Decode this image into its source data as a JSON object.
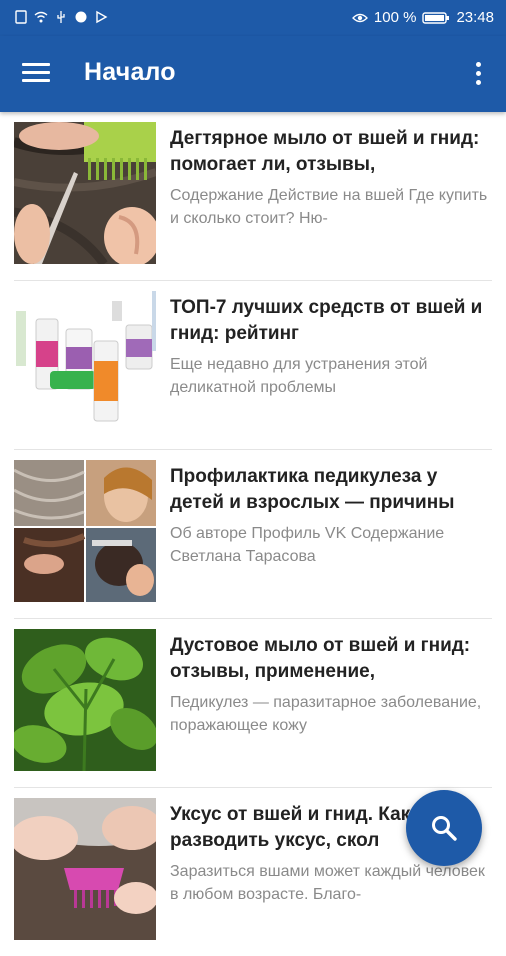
{
  "status_bar": {
    "battery": "100 %",
    "time": "23:48"
  },
  "app_bar": {
    "title": "Начало",
    "menu_icon": "hamburger-menu-icon",
    "more_icon": "more-vert-icon"
  },
  "articles": [
    {
      "headline": "Дегтярное мыло от вшей и гнид: помогает ли, отзывы,",
      "excerpt": "Содержание Действие на вшей Где купить и сколько стоит? Ню-"
    },
    {
      "headline": "ТОП-7 лучших средств от вшей и гнид: рейтинг",
      "excerpt": "Еще недавно для устранения этой деликатной проблемы"
    },
    {
      "headline": "Профилактика педикулеза у детей и взрослых — причины",
      "excerpt": "Об авторе Профиль VK Содержание Светлана Тарасова"
    },
    {
      "headline": "Дустовое мыло от вшей и гнид: отзывы, применение,",
      "excerpt": "Педикулез — паразитарное заболевание, поражающее кожу"
    },
    {
      "headline": "Уксус от вшей и гнид. Как разводить уксус, скол",
      "excerpt": "Заразиться вшами может каждый человек в любом возрасте. Благо-"
    }
  ],
  "fab": {
    "icon": "search-icon"
  },
  "colors": {
    "primary": "#1e5aa8",
    "headline": "#222222",
    "excerpt": "#8a8a8a"
  }
}
